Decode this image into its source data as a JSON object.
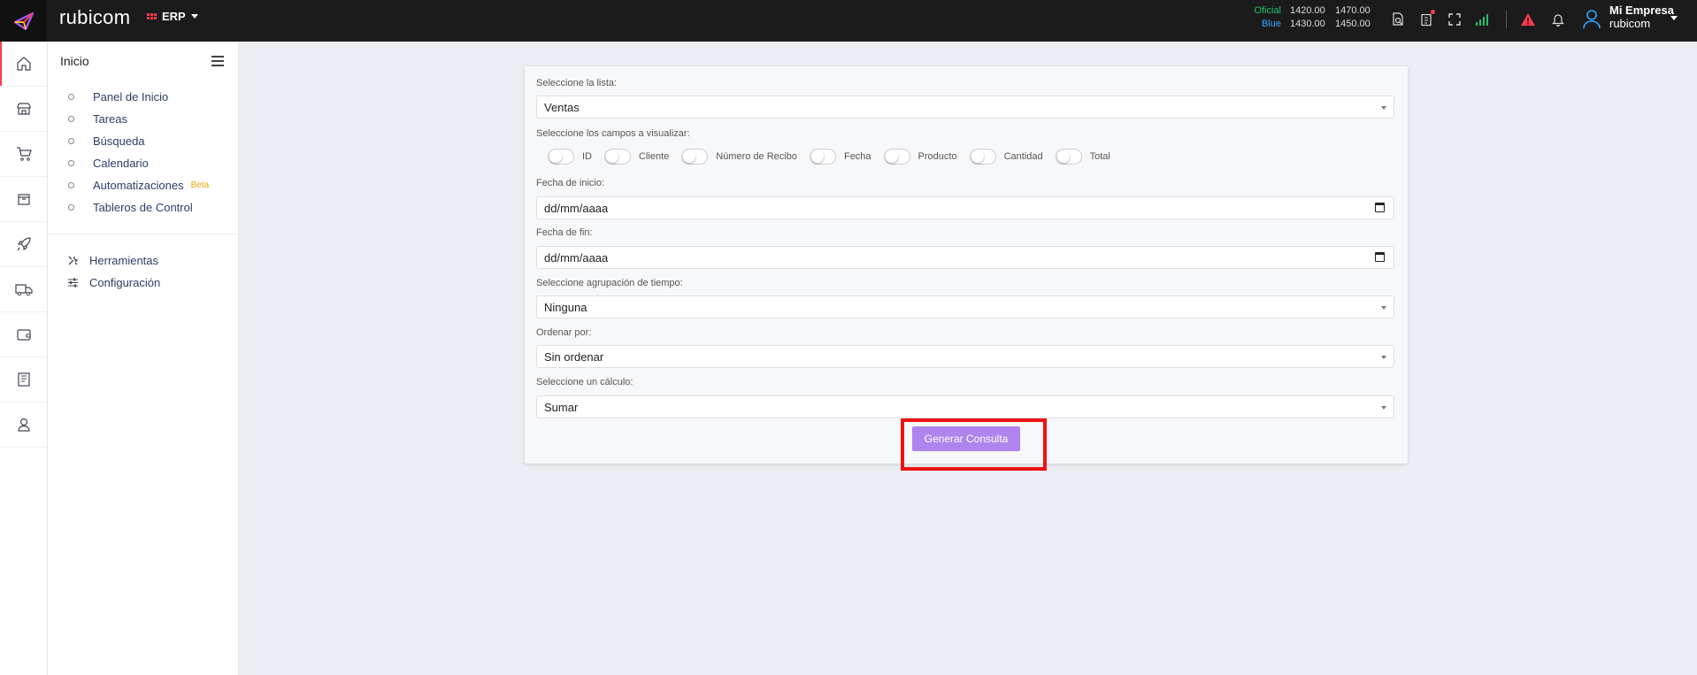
{
  "header": {
    "brand": "rubicom",
    "module": "ERP",
    "rates": {
      "oficial_label": "Oficial",
      "blue_label": "Blue",
      "oficial_buy": "1420.00",
      "oficial_sell": "1470.00",
      "blue_buy": "1430.00",
      "blue_sell": "1450.00"
    },
    "company": {
      "name": "Mi Empresa",
      "user": "rubicom"
    },
    "icons": [
      "search-doc-icon",
      "clipboard-icon",
      "fullscreen-icon",
      "signal-icon",
      "alert-icon",
      "bell-icon",
      "user-icon"
    ],
    "colors": {
      "accent": "#ff3b4d",
      "oficial": "#1fc26d",
      "blue": "#2ea7ff"
    }
  },
  "rail": {
    "icons": [
      "home-icon",
      "store-icon",
      "cart-icon",
      "box-icon",
      "rocket-icon",
      "truck-icon",
      "wallet-icon",
      "book-icon",
      "person-icon"
    ]
  },
  "sidebar": {
    "title": "Inicio",
    "items": [
      {
        "label": "Panel de Inicio"
      },
      {
        "label": "Tareas"
      },
      {
        "label": "Búsqueda"
      },
      {
        "label": "Calendario"
      },
      {
        "label": "Automatizaciones",
        "badge": "Beta"
      },
      {
        "label": "Tableros de Control"
      }
    ],
    "tools": [
      {
        "label": "Herramientas",
        "icon": "tools-icon"
      },
      {
        "label": "Configuración",
        "icon": "sliders-icon"
      }
    ]
  },
  "form": {
    "list_label": "Seleccione la lista:",
    "list_value": "Ventas",
    "fields_label": "Seleccione los campos a visualizar:",
    "fields": [
      "ID",
      "Cliente",
      "Número de Recibo",
      "Fecha",
      "Producto",
      "Cantidad",
      "Total"
    ],
    "start_label": "Fecha de inicio:",
    "start_value": "dd/mm/aaaa",
    "end_label": "Fecha de fin:",
    "end_value": "dd/mm/aaaa",
    "grouping_label": "Seleccione agrupación de tiempo:",
    "grouping_value": "Ninguna",
    "order_label": "Ordenar por:",
    "order_value": "Sin ordenar",
    "calc_label": "Seleccione un cálculo:",
    "calc_value": "Sumar",
    "submit_label": "Generar Consulta",
    "submit_color": "#b084ee"
  }
}
